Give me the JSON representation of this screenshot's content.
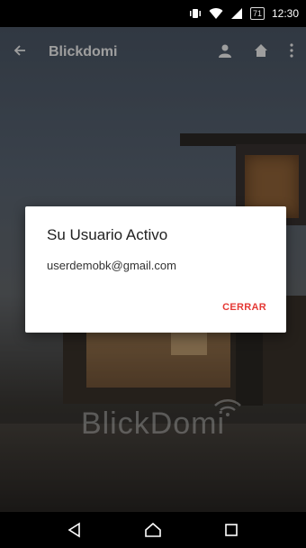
{
  "status_bar": {
    "battery": "71",
    "time": "12:30",
    "icons": [
      "vibrate-icon",
      "wifi-icon",
      "signal-icon",
      "battery-icon"
    ]
  },
  "app_bar": {
    "title": "Blickdomi",
    "icons": [
      "back-arrow-icon",
      "user-icon",
      "home-icon",
      "more-vert-icon"
    ]
  },
  "background": {
    "watermark_text": "BlickDomi"
  },
  "dialog": {
    "title": "Su Usuario Activo",
    "message": "userdemobk@gmail.com",
    "button_label": "CERRAR"
  },
  "colors": {
    "accent": "#e53935"
  },
  "nav_bar": {
    "icons": [
      "back-icon",
      "home-icon",
      "recents-icon"
    ]
  }
}
